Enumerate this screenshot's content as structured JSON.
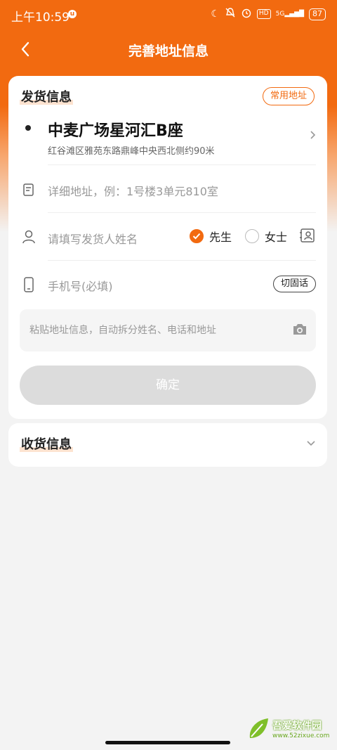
{
  "status_bar": {
    "time": "上午10:59",
    "notice_badge": "u",
    "signal_label": "5G",
    "hd_label": "HD",
    "battery": "87"
  },
  "nav": {
    "title": "完善地址信息",
    "back_icon": "chevron-left-icon"
  },
  "sender": {
    "section_title": "发货信息",
    "common_address_label": "常用地址",
    "address_main": "中麦广场星河汇B座",
    "address_sub": "红谷滩区雅苑东路鼎峰中央西北侧约90米",
    "detail_placeholder": "详细地址，例：1号楼3单元810室",
    "name_placeholder": "请填写发货人姓名",
    "gender_options": [
      "先生",
      "女士"
    ],
    "gender_selected": "先生",
    "phone_placeholder": "手机号(必填)",
    "switch_landline_label": "切固话",
    "paste_placeholder": "粘贴地址信息，自动拆分姓名、电话和地址",
    "confirm_label": "确定"
  },
  "receiver": {
    "section_title": "收货信息"
  },
  "watermark": {
    "name": "吾爱软件园",
    "url": "www.52zixue.com"
  },
  "colors": {
    "accent": "#f26a10",
    "disabled_button": "#dcdcdc",
    "page_bg": "#f3f3f3"
  }
}
